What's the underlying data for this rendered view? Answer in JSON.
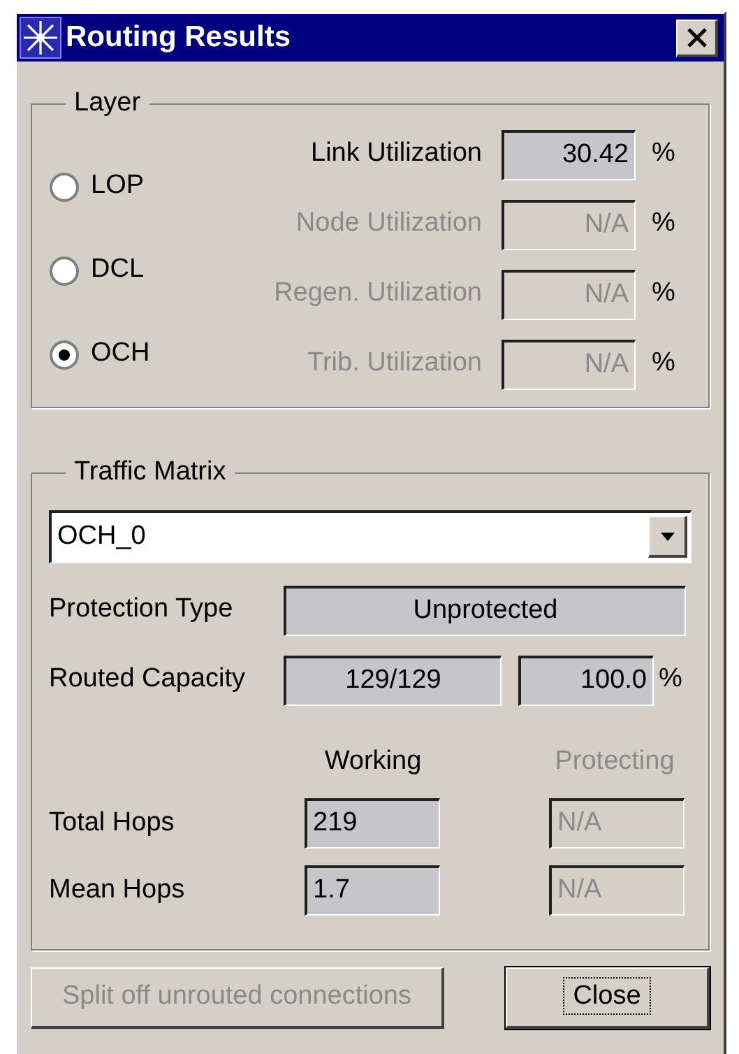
{
  "window": {
    "title": "Routing Results"
  },
  "layer": {
    "legend": "Layer",
    "options": [
      {
        "label": "LOP",
        "selected": false
      },
      {
        "label": "DCL",
        "selected": false
      },
      {
        "label": "OCH",
        "selected": true
      }
    ],
    "metrics": [
      {
        "label": "Link Utilization",
        "value": "30.42",
        "unit": "%",
        "disabled": false
      },
      {
        "label": "Node Utilization",
        "value": "N/A",
        "unit": "%",
        "disabled": true
      },
      {
        "label": "Regen. Utilization",
        "value": "N/A",
        "unit": "%",
        "disabled": true
      },
      {
        "label": "Trib. Utilization",
        "value": "N/A",
        "unit": "%",
        "disabled": true
      }
    ]
  },
  "traffic_matrix": {
    "legend": "Traffic Matrix",
    "dropdown": {
      "value": "OCH_0"
    },
    "protection_type": {
      "label": "Protection Type",
      "value": "Unprotected"
    },
    "routed_capacity": {
      "label": "Routed Capacity",
      "value": "129/129",
      "percent": "100.0",
      "unit": "%"
    },
    "columns": [
      {
        "label": "Working",
        "disabled": false
      },
      {
        "label": "Protecting",
        "disabled": true
      }
    ],
    "rows": [
      {
        "label": "Total Hops",
        "values": [
          "219",
          "N/A"
        ]
      },
      {
        "label": "Mean Hops",
        "values": [
          "1.7",
          "N/A"
        ]
      }
    ]
  },
  "buttons": [
    {
      "label": "Split off unrouted connections",
      "disabled": true,
      "focused": false
    },
    {
      "label": "Close",
      "disabled": false,
      "focused": true
    }
  ]
}
